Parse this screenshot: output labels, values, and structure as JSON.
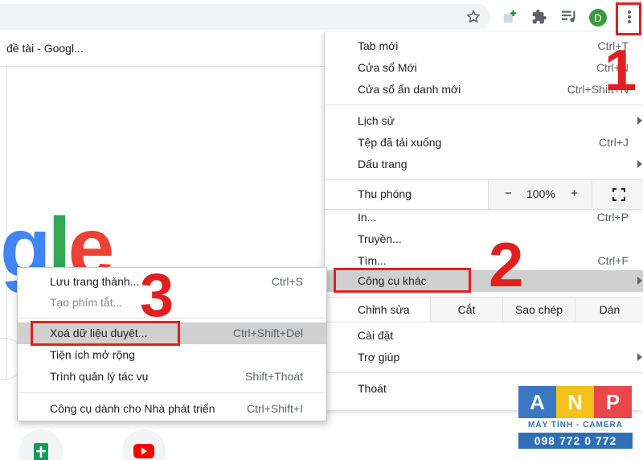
{
  "browser": {
    "tab_title": "đề tài - Googl...",
    "avatar_letter": "D",
    "logo_letters": [
      "g",
      "l",
      "e"
    ]
  },
  "main_menu": {
    "items": [
      {
        "label": "Tab mới",
        "shortcut": "Ctrl+T"
      },
      {
        "label": "Cửa sổ Mới",
        "shortcut": "Ctrl+N"
      },
      {
        "label": "Cửa sổ ẩn danh mới",
        "shortcut": "Ctrl+Shift+N"
      },
      {
        "label": "Lịch sử",
        "shortcut": ""
      },
      {
        "label": "Tệp đã tải xuống",
        "shortcut": "Ctrl+J"
      },
      {
        "label": "Dấu trang",
        "shortcut": ""
      },
      {
        "label": "In...",
        "shortcut": "Ctrl+P"
      },
      {
        "label": "Truyền...",
        "shortcut": ""
      },
      {
        "label": "Tìm...",
        "shortcut": "Ctrl+F"
      },
      {
        "label": "Công cụ khác",
        "shortcut": ""
      },
      {
        "label": "Cài đặt",
        "shortcut": ""
      },
      {
        "label": "Trợ giúp",
        "shortcut": ""
      },
      {
        "label": "Thoát",
        "shortcut": ""
      }
    ],
    "zoom": {
      "label": "Thu phóng",
      "minus": "−",
      "value": "100%",
      "plus": "+"
    },
    "edit": {
      "label": "Chỉnh sửa",
      "cut": "Cắt",
      "copy": "Sao chép",
      "paste": "Dán"
    }
  },
  "sub_menu": {
    "items": [
      {
        "label": "Lưu trang thành...",
        "shortcut": "Ctrl+S"
      },
      {
        "label": "Tạo phím tắt...",
        "shortcut": ""
      },
      {
        "label": "Xoá dữ liệu duyệt...",
        "shortcut": "Ctrl+Shift+Del"
      },
      {
        "label": "Tiện ích mở rộng",
        "shortcut": ""
      },
      {
        "label": "Trình quản lý tác vụ",
        "shortcut": "Shift+Thoát"
      },
      {
        "label": "Công cụ dành cho Nhà phát triển",
        "shortcut": "Ctrl+Shift+I"
      }
    ]
  },
  "annotations": {
    "step1": "1",
    "step2": "2",
    "step3": "3",
    "accent_color": "#e02020"
  },
  "watermark": {
    "letters": [
      "A",
      "N",
      "P"
    ],
    "tagline": "MÁY TÍNH - CAMERA",
    "phone": "098 772 0 772"
  }
}
